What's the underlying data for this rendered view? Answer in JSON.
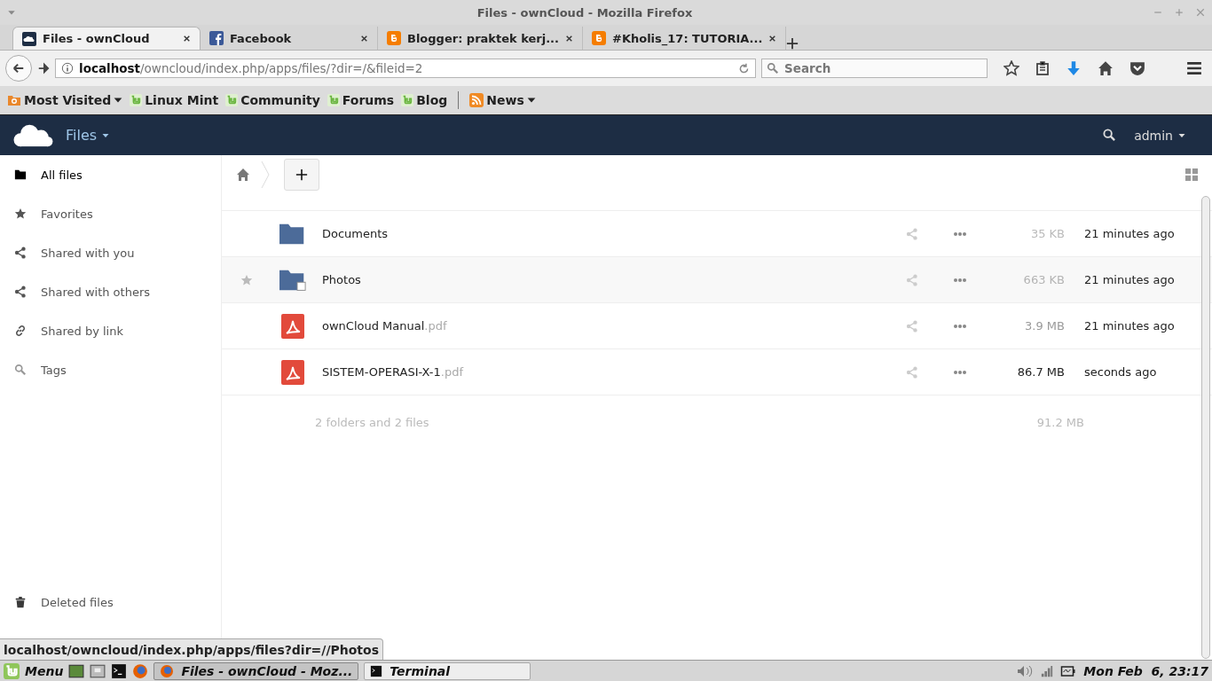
{
  "window": {
    "title": "Files - ownCloud - Mozilla Firefox"
  },
  "tabs": [
    {
      "label": "Files - ownCloud",
      "kind": "owncloud",
      "selected": true
    },
    {
      "label": "Facebook",
      "kind": "facebook",
      "selected": false
    },
    {
      "label": "Blogger: praktek kerj...",
      "kind": "blogger",
      "selected": false
    },
    {
      "label": "#Kholis_17: TUTORIA...",
      "kind": "blogger",
      "selected": false
    }
  ],
  "address": {
    "host": "localhost",
    "path": "/owncloud/index.php/apps/files/?dir=/&fileid=2"
  },
  "search": {
    "placeholder": "Search"
  },
  "bookmarks": [
    {
      "label": "Most Visited",
      "kind": "most",
      "menu": true
    },
    {
      "label": "Linux Mint",
      "kind": "mint",
      "menu": false
    },
    {
      "label": "Community",
      "kind": "mint",
      "menu": false
    },
    {
      "label": "Forums",
      "kind": "mint",
      "menu": false
    },
    {
      "label": "Blog",
      "kind": "mint",
      "menu": false
    },
    {
      "label": "News",
      "kind": "rss",
      "menu": true
    }
  ],
  "app": {
    "name": "Files",
    "user": "admin"
  },
  "sidebar": {
    "items": [
      {
        "label": "All files",
        "kind": "folder",
        "selected": true
      },
      {
        "label": "Favorites",
        "kind": "star",
        "selected": false
      },
      {
        "label": "Shared with you",
        "kind": "share",
        "selected": false
      },
      {
        "label": "Shared with others",
        "kind": "share",
        "selected": false
      },
      {
        "label": "Shared by link",
        "kind": "link",
        "selected": false
      },
      {
        "label": "Tags",
        "kind": "search",
        "selected": false
      }
    ],
    "bottom": [
      {
        "label": "Deleted files",
        "kind": "trash",
        "selected": false
      }
    ]
  },
  "table": {
    "rows": [
      {
        "kind": "folder",
        "name": "Documents",
        "ext": "",
        "size": "35 KB",
        "color": "#bbbbbb",
        "modified": "21 minutes ago",
        "hovered": false,
        "overlay": false
      },
      {
        "kind": "folder",
        "name": "Photos",
        "ext": "",
        "size": "663 KB",
        "color": "#b4b4b4",
        "modified": "21 minutes ago",
        "hovered": true,
        "overlay": true
      },
      {
        "kind": "pdf",
        "name": "ownCloud Manual",
        "ext": ".pdf",
        "size": "3.9 MB",
        "color": "#9a9a9a",
        "modified": "21 minutes ago",
        "hovered": false
      },
      {
        "kind": "pdf",
        "name": "SISTEM-OPERASI-X-1",
        "ext": ".pdf",
        "size": "86.7 MB",
        "color": "#222222",
        "modified": "seconds ago",
        "hovered": false
      }
    ],
    "summary": {
      "label": "2 folders and 2 files",
      "size": "91.2 MB"
    }
  },
  "status_link": "localhost/owncloud/index.php/apps/files?dir=//Photos",
  "taskbar": {
    "menu": "Menu",
    "windows": [
      {
        "label": "Files - ownCloud - Moz...",
        "kind": "firefox",
        "selected": true
      },
      {
        "label": "Terminal",
        "kind": "terminal",
        "selected": false
      }
    ],
    "clock": "Mon Feb  6, 23:17"
  }
}
